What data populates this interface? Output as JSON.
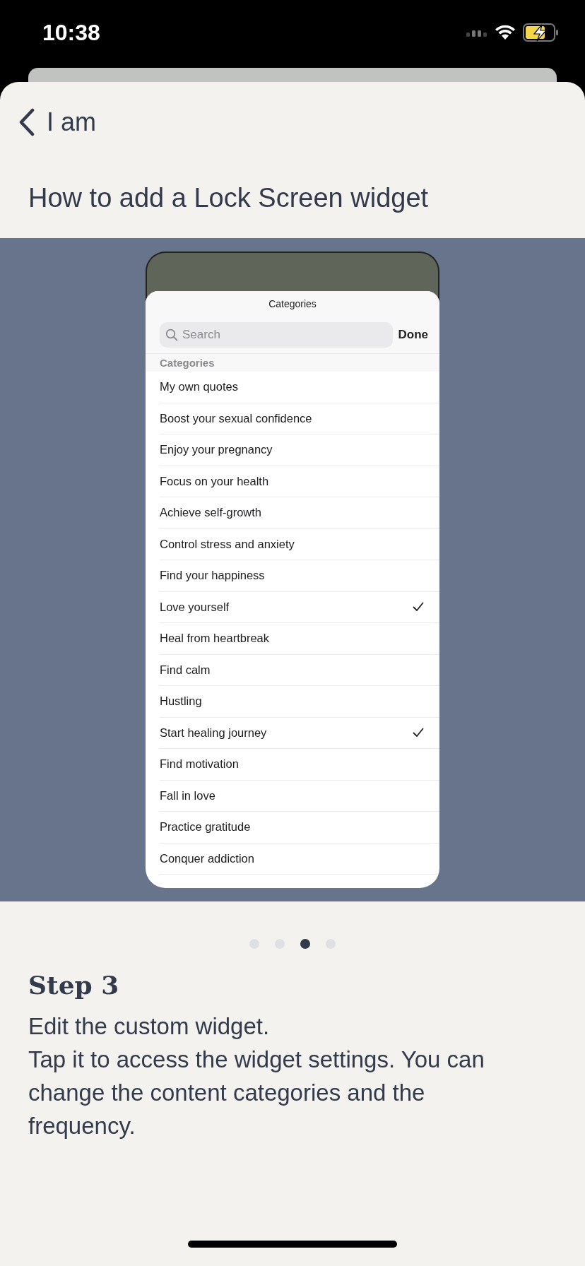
{
  "status_bar": {
    "time": "10:38"
  },
  "nav": {
    "back_label": "I am"
  },
  "title": "How to add a Lock Screen widget",
  "preview": {
    "sheet_title": "Categories",
    "search": {
      "placeholder": "Search"
    },
    "done": "Done",
    "section": "Categories",
    "items": [
      {
        "label": "My own quotes",
        "checked": false
      },
      {
        "label": "Boost your sexual confidence",
        "checked": false
      },
      {
        "label": "Enjoy your pregnancy",
        "checked": false
      },
      {
        "label": "Focus on your health",
        "checked": false
      },
      {
        "label": "Achieve self-growth",
        "checked": false
      },
      {
        "label": "Control stress and anxiety",
        "checked": false
      },
      {
        "label": "Find your happiness",
        "checked": false
      },
      {
        "label": "Love yourself",
        "checked": true
      },
      {
        "label": "Heal from heartbreak",
        "checked": false
      },
      {
        "label": "Find calm",
        "checked": false
      },
      {
        "label": "Hustling",
        "checked": false
      },
      {
        "label": "Start healing journey",
        "checked": true
      },
      {
        "label": "Find motivation",
        "checked": false
      },
      {
        "label": "Fall in love",
        "checked": false
      },
      {
        "label": "Practice gratitude",
        "checked": false
      },
      {
        "label": "Conquer addiction",
        "checked": false
      }
    ]
  },
  "pager": [
    {
      "selected": false
    },
    {
      "selected": false
    },
    {
      "selected": true
    },
    {
      "selected": false
    }
  ],
  "step": {
    "heading": "Step 3",
    "lead": "Edit the custom widget.",
    "body": "Tap it to access the widget settings. You can change the content categories and the frequency."
  }
}
